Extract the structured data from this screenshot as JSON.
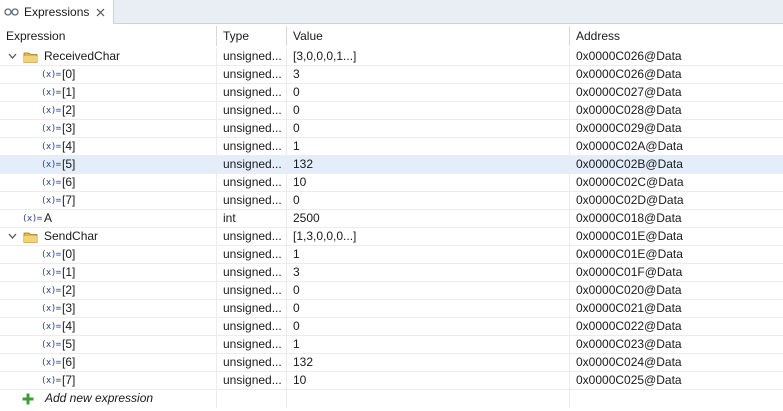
{
  "tab": {
    "title": "Expressions",
    "icon": "expressions-view-icon",
    "close_icon": "close-icon"
  },
  "columns": {
    "expression": "Expression",
    "type": "Type",
    "value": "Value",
    "address": "Address"
  },
  "rows": [
    {
      "kind": "parent",
      "depth": 0,
      "expanded": true,
      "name": "ReceivedChar",
      "type": "unsigned...",
      "value": "[3,0,0,0,1...]",
      "address": "0x0000C026@Data"
    },
    {
      "kind": "child",
      "depth": 1,
      "name": "[0]",
      "type": "unsigned...",
      "value": "3",
      "address": "0x0000C026@Data"
    },
    {
      "kind": "child",
      "depth": 1,
      "name": "[1]",
      "type": "unsigned...",
      "value": "0",
      "address": "0x0000C027@Data"
    },
    {
      "kind": "child",
      "depth": 1,
      "name": "[2]",
      "type": "unsigned...",
      "value": "0",
      "address": "0x0000C028@Data"
    },
    {
      "kind": "child",
      "depth": 1,
      "name": "[3]",
      "type": "unsigned...",
      "value": "0",
      "address": "0x0000C029@Data"
    },
    {
      "kind": "child",
      "depth": 1,
      "name": "[4]",
      "type": "unsigned...",
      "value": "1",
      "address": "0x0000C02A@Data"
    },
    {
      "kind": "child",
      "depth": 1,
      "name": "[5]",
      "type": "unsigned...",
      "value": "132",
      "address": "0x0000C02B@Data",
      "selected": true
    },
    {
      "kind": "child",
      "depth": 1,
      "name": "[6]",
      "type": "unsigned...",
      "value": "10",
      "address": "0x0000C02C@Data"
    },
    {
      "kind": "child",
      "depth": 1,
      "name": "[7]",
      "type": "unsigned...",
      "value": "0",
      "address": "0x0000C02D@Data"
    },
    {
      "kind": "leaf",
      "depth": 0,
      "name": "A",
      "type": "int",
      "value": "2500",
      "address": "0x0000C018@Data"
    },
    {
      "kind": "parent",
      "depth": 0,
      "expanded": true,
      "name": "SendChar",
      "type": "unsigned...",
      "value": "[1,3,0,0,0...]",
      "address": "0x0000C01E@Data"
    },
    {
      "kind": "child",
      "depth": 1,
      "name": "[0]",
      "type": "unsigned...",
      "value": "1",
      "address": "0x0000C01E@Data"
    },
    {
      "kind": "child",
      "depth": 1,
      "name": "[1]",
      "type": "unsigned...",
      "value": "3",
      "address": "0x0000C01F@Data"
    },
    {
      "kind": "child",
      "depth": 1,
      "name": "[2]",
      "type": "unsigned...",
      "value": "0",
      "address": "0x0000C020@Data"
    },
    {
      "kind": "child",
      "depth": 1,
      "name": "[3]",
      "type": "unsigned...",
      "value": "0",
      "address": "0x0000C021@Data"
    },
    {
      "kind": "child",
      "depth": 1,
      "name": "[4]",
      "type": "unsigned...",
      "value": "0",
      "address": "0x0000C022@Data"
    },
    {
      "kind": "child",
      "depth": 1,
      "name": "[5]",
      "type": "unsigned...",
      "value": "1",
      "address": "0x0000C023@Data"
    },
    {
      "kind": "child",
      "depth": 1,
      "name": "[6]",
      "type": "unsigned...",
      "value": "132",
      "address": "0x0000C024@Data"
    },
    {
      "kind": "child",
      "depth": 1,
      "name": "[7]",
      "type": "unsigned...",
      "value": "10",
      "address": "0x0000C025@Data"
    }
  ],
  "variable_icon_text": "(x)=",
  "add_expression": {
    "label": "Add new expression",
    "icon": "add-plus-icon"
  },
  "colors": {
    "selected_row": "#e4eefb",
    "tab_bar": "#e9eef5",
    "variable_icon": "#2c3f8f",
    "folder": "#e0b84a",
    "add_icon": "#3f9c35"
  }
}
